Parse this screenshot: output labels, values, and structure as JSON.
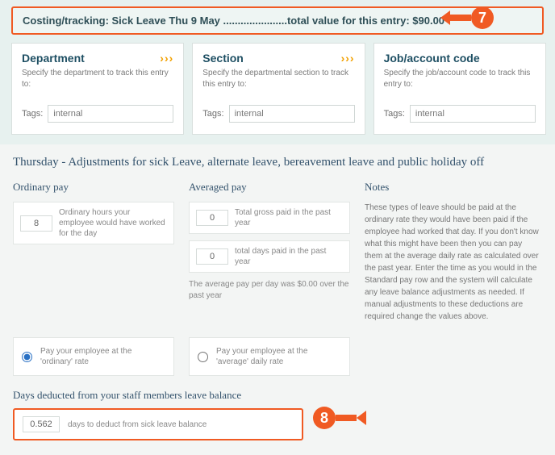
{
  "callouts": {
    "seven": "7",
    "eight": "8"
  },
  "costing": {
    "line": "Costing/tracking: Sick Leave Thu 9 May ......................total value for this entry: $90.00"
  },
  "dept": {
    "title": "Department",
    "sub": "Specify the department to track this entry to:",
    "tags_label": "Tags:",
    "value": "internal"
  },
  "section": {
    "title": "Section",
    "sub": "Specify the departmental section to track this entry to:",
    "tags_label": "Tags:",
    "value": "internal"
  },
  "job": {
    "title": "Job/account code",
    "sub": "Specify the job/account code to track this entry to:",
    "tags_label": "Tags:",
    "value": "internal"
  },
  "panel": {
    "title": "Thursday - Adjustments for sick Leave, alternate leave, bereavement leave and public holiday off",
    "ord": {
      "heading": "Ordinary pay",
      "hours": "8",
      "hours_label": "Ordinary hours your employee would have worked for the day"
    },
    "avg": {
      "heading": "Averaged pay",
      "gross": "0",
      "gross_label": "Total gross paid in the past year",
      "days": "0",
      "days_label": "total days paid in the past year",
      "note": "The average pay per day was $0.00 over the past year"
    },
    "notes": {
      "heading": "Notes",
      "body": "These types of leave should be paid at the ordinary rate they would have been paid if the employee had worked that day. If you don't know what this might have been then you can pay them at the average daily rate as calculated over the past year. Enter the time as you would in the Standard pay row and the system will calculate any leave balance adjustments as needed. If manual adjustments to these deductions are required change the values above."
    },
    "rate": {
      "ord_label": "Pay your employee at the 'ordinary' rate",
      "avg_label": "Pay your employee at the 'average' daily rate"
    },
    "deduct": {
      "heading": "Days deducted from your staff members leave balance",
      "value": "0.562",
      "label": "days to deduct from sick leave balance"
    }
  }
}
